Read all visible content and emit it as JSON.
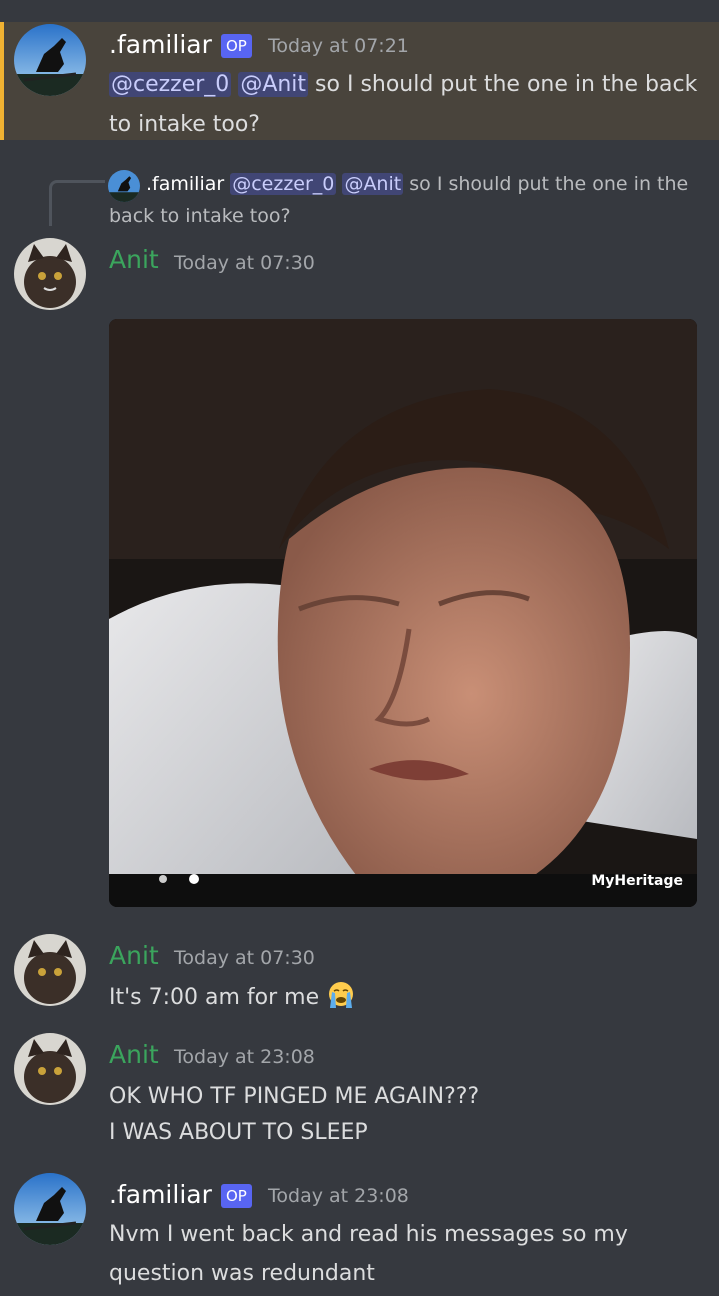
{
  "messages": [
    {
      "author": ".familiar",
      "badge": "OP",
      "timestamp": "Today at 07:21",
      "mention1": "@cezzer_0",
      "mention2": "@Anit",
      "line1_rest": "so I should put the one in the back",
      "line2": "to intake too?"
    },
    {
      "reply": {
        "author": ".familiar",
        "mention1": "@cezzer_0",
        "mention2": "@Anit",
        "line1_rest": "so I should put the one in the",
        "line2": "back to intake too?"
      },
      "author": "Anit",
      "timestamp": "Today at 07:30",
      "attachment": {
        "type": "gif",
        "watermark": "MyHeritage"
      }
    },
    {
      "author": "Anit",
      "timestamp": "Today at 07:30",
      "text": "It's 7:00 am for me",
      "emoji": "loudly-crying-face-icon"
    },
    {
      "author": "Anit",
      "timestamp": "Today at 23:08",
      "line1": "OK WHO TF PINGED ME AGAIN???",
      "line2": "I WAS ABOUT TO SLEEP"
    },
    {
      "author": ".familiar",
      "badge": "OP",
      "timestamp": "Today at 23:08",
      "line1": "Nvm I went back and read his messages so my",
      "line2": "question was redundant"
    }
  ],
  "colors": {
    "background": "#36393f",
    "highlight": "#49443c",
    "highlight_bar": "#f0b232",
    "anit_name": "#3ba55d",
    "mention_bg": "#414675",
    "op_badge": "#5865f2"
  }
}
